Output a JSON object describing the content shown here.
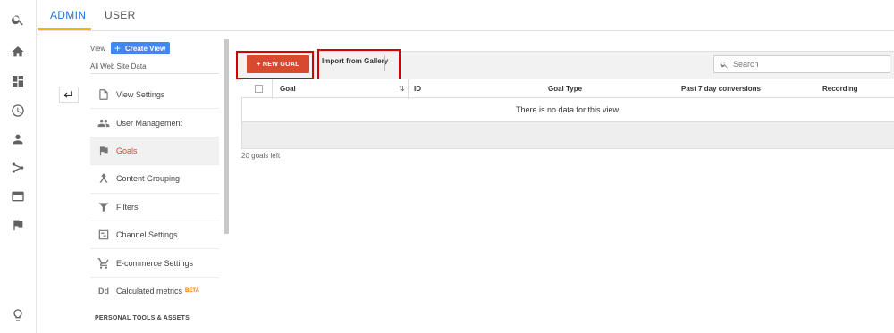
{
  "rail": {
    "icons": [
      "search-icon",
      "home-icon",
      "dashboard-icon",
      "clock-icon",
      "person-icon",
      "acquisition-icon",
      "behavior-icon",
      "flag-icon",
      "lightbulb-icon"
    ]
  },
  "tabs": {
    "admin": "ADMIN",
    "user": "USER"
  },
  "view": {
    "label": "View",
    "create_button": "Create View",
    "name": "All Web Site Data"
  },
  "menu": {
    "items": [
      {
        "label": "View Settings",
        "icon": "document-icon"
      },
      {
        "label": "User Management",
        "icon": "people-icon"
      },
      {
        "label": "Goals",
        "icon": "flag-icon",
        "active": true
      },
      {
        "label": "Content Grouping",
        "icon": "grouping-icon"
      },
      {
        "label": "Filters",
        "icon": "filter-icon"
      },
      {
        "label": "Channel Settings",
        "icon": "channel-icon"
      },
      {
        "label": "E-commerce Settings",
        "icon": "cart-icon"
      },
      {
        "label": "Calculated metrics",
        "icon": "dd-icon",
        "badge": "BETA"
      }
    ],
    "section_heading": "PERSONAL TOOLS & ASSETS"
  },
  "toolbar": {
    "new_goal": "+ NEW GOAL",
    "import": "Import from Gallery",
    "search_placeholder": "Search"
  },
  "table": {
    "columns": [
      "Goal",
      "ID",
      "Goal Type",
      "Past 7 day conversions",
      "Recording"
    ],
    "empty_message": "There is no data for this view.",
    "goals_left": "20 goals left"
  },
  "colors": {
    "accent": "#1a73e8",
    "primary_button": "#d84a2f",
    "create_view": "#4285f4",
    "highlight_box": "#d50000",
    "active_menu_text": "#d9452a"
  }
}
